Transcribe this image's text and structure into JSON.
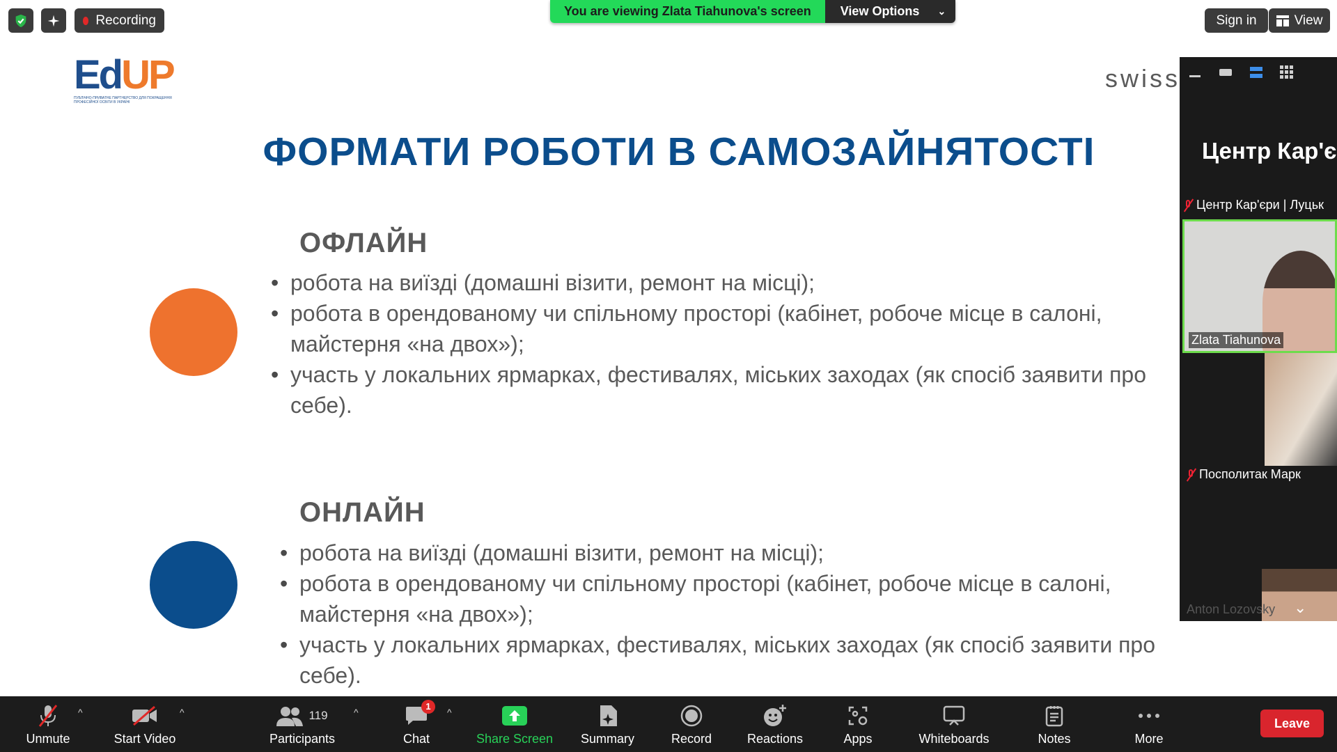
{
  "top_bar": {
    "recording_label": "Recording",
    "banner_text": "You are viewing Zlata Tiahunova's screen",
    "view_options_label": "View Options",
    "sign_in_label": "Sign in",
    "view_label": "View"
  },
  "slide": {
    "logo_text": "EdUP",
    "logo_tagline": "ПУБЛІЧНО-ПРИВАТНЕ ПАРТНЕРСТВО ДЛЯ ПОКРАЩЕННЯ ПРОФЕСІЙНОЇ ОСВІТИ В УКРАЇНІ",
    "partner_logo_text": "swissc",
    "title": "ФОРМАТИ РОБОТИ В САМОЗАЙНЯТОСТІ",
    "sections": [
      {
        "heading": "ОФЛАЙН",
        "bullets": [
          "робота на виїзді (домашні візити, ремонт на місці);",
          "робота в орендованому чи спільному просторі (кабінет, робоче місце в салоні, майстерня «на двох»);",
          "участь у локальних ярмарках, фестивалях, міських заходах (як спосіб заявити про себе)."
        ]
      },
      {
        "heading": "ОНЛАЙН",
        "bullets": [
          "робота на виїзді (домашні візити, ремонт на місці);",
          "робота в орендованому чи спільному просторі (кабінет, робоче місце в салоні, майстерня «на двох»);",
          "участь у локальних ярмарках, фестивалях, міських заходах (як спосіб заявити про себе)."
        ]
      }
    ]
  },
  "gallery": {
    "tile_title": "Центр Кар'є",
    "participants": [
      {
        "name": "Центр Кар'єри | Луцьк",
        "muted": true
      },
      {
        "name": "Zlata Tiahunova",
        "muted": false,
        "speaking": true
      },
      {
        "name": "Посполитак Марк",
        "muted": true
      },
      {
        "name": "Anton Lozovsky",
        "muted": false
      }
    ]
  },
  "toolbar": {
    "unmute": "Unmute",
    "start_video": "Start Video",
    "participants": "Participants",
    "participants_count": "119",
    "chat": "Chat",
    "chat_badge": "1",
    "share_screen": "Share Screen",
    "summary": "Summary",
    "record": "Record",
    "reactions": "Reactions",
    "apps": "Apps",
    "whiteboards": "Whiteboards",
    "notes": "Notes",
    "more": "More",
    "leave": "Leave"
  },
  "colors": {
    "accent_green": "#23d959",
    "title_blue": "#0b4d8c",
    "orange": "#ee722e",
    "leave_red": "#d9252d"
  }
}
